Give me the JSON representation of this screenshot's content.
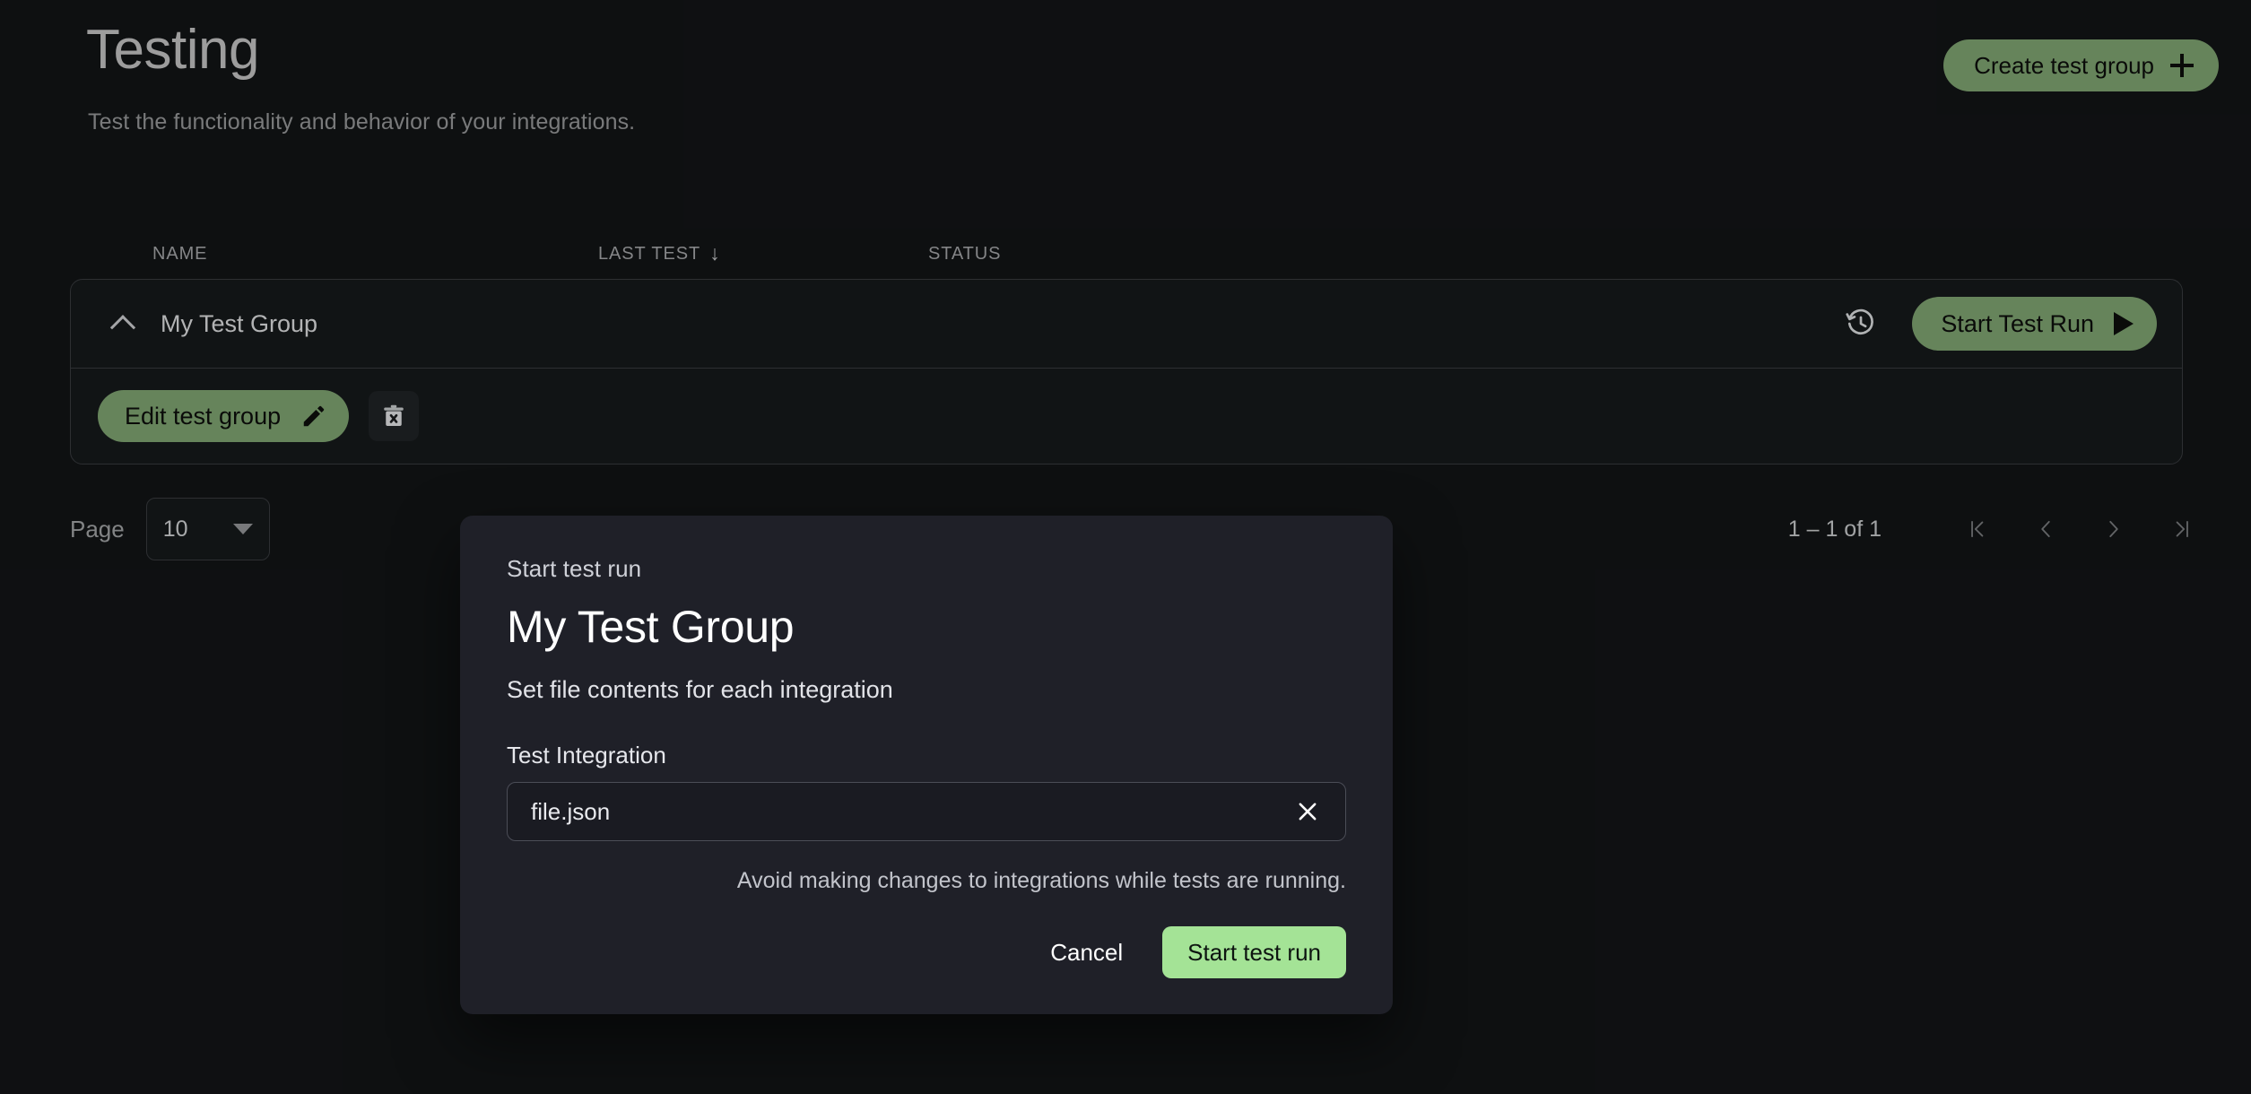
{
  "page": {
    "title": "Testing",
    "subtitle": "Test the functionality and behavior of your integrations.",
    "create_button": "Create test group"
  },
  "table": {
    "columns": {
      "name": "NAME",
      "last_test": "LAST TEST",
      "status": "STATUS"
    },
    "sort_indicator": "↓",
    "rows": [
      {
        "name": "My Test Group",
        "last_test": "",
        "status": "",
        "expanded": true,
        "start_run_label": "Start Test Run",
        "edit_label": "Edit test group"
      }
    ]
  },
  "pagination": {
    "page_label": "Page",
    "page_size": "10",
    "range": "1 – 1 of 1"
  },
  "modal": {
    "eyebrow": "Start test run",
    "title": "My Test Group",
    "subtitle": "Set file contents for each integration",
    "field_label": "Test Integration",
    "field_value": "file.json",
    "field_placeholder": "file.json",
    "hint": "Avoid making changes to integrations while tests are running.",
    "cancel_label": "Cancel",
    "confirm_label": "Start test run"
  },
  "colors": {
    "page_background": "#131517",
    "accent_green": "#83a975",
    "accent_green_bright": "#a4e396",
    "modal_background": "#1f2028",
    "border": "#3a3d40"
  }
}
